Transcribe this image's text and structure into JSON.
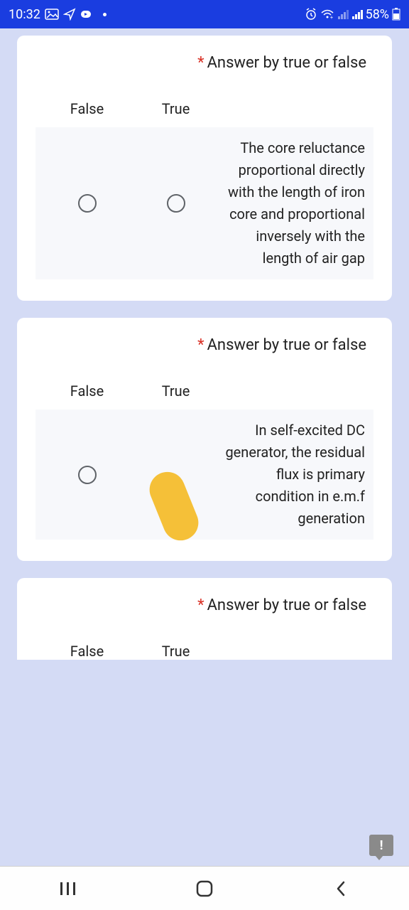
{
  "status": {
    "time": "10:32",
    "battery": "58%"
  },
  "form": {
    "question_title": "Answer by true or false",
    "required_mark": "*",
    "headers": {
      "false": "False",
      "true": "True"
    }
  },
  "questions": [
    {
      "statement": "The core reluctance proportional directly with the length of iron core and proportional inversely with the length of air gap"
    },
    {
      "statement": "In self-excited DC generator, the residual flux is primary condition in e.m.f generation"
    },
    {
      "statement": ""
    }
  ],
  "feedback": {
    "mark": "!"
  }
}
